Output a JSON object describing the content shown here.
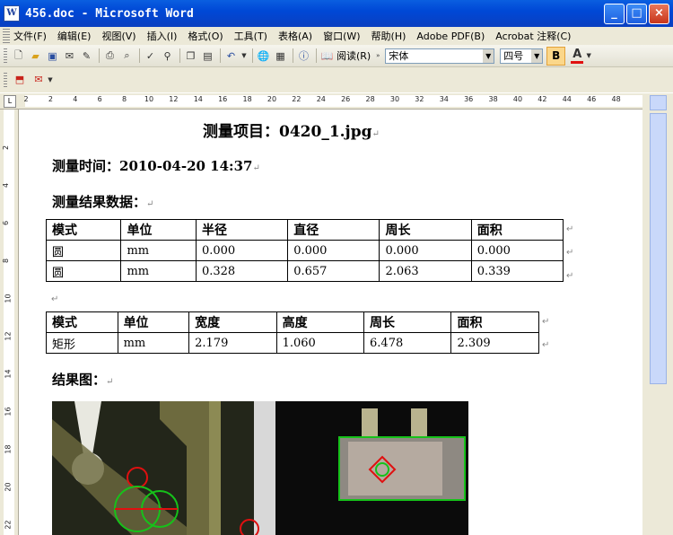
{
  "window": {
    "icon": "W",
    "title": "456.doc - Microsoft Word"
  },
  "menu": [
    "文件(F)",
    "编辑(E)",
    "视图(V)",
    "插入(I)",
    "格式(O)",
    "工具(T)",
    "表格(A)",
    "窗口(W)",
    "帮助(H)",
    "Adobe PDF(B)",
    "Acrobat 注释(C)"
  ],
  "toolbar": {
    "read_label": "阅读(R)",
    "font_name": "宋体",
    "font_size": "四号",
    "bold_label": "B",
    "color_label": "A"
  },
  "ruler": {
    "h_ticks": [
      "2",
      "2",
      "4",
      "6",
      "8",
      "10",
      "12",
      "14",
      "16",
      "18",
      "20",
      "22",
      "24",
      "26",
      "28",
      "30",
      "32",
      "34",
      "36",
      "38",
      "40",
      "42",
      "44",
      "46",
      "48"
    ],
    "v_ticks": [
      "2",
      "4",
      "6",
      "8",
      "10",
      "12",
      "14",
      "16",
      "18",
      "20",
      "22"
    ]
  },
  "document": {
    "title": "测量项目：0420_1.jpg",
    "time_label": "测量时间：2010-04-20   14:37",
    "results_heading": "测量结果数据：",
    "table1": {
      "headers": [
        "模式",
        "单位",
        "半径",
        "直径",
        "周长",
        "面积"
      ],
      "rows": [
        [
          "圆",
          "mm",
          "0.000",
          "0.000",
          "0.000",
          "0.000"
        ],
        [
          "圆",
          "mm",
          "0.328",
          "0.657",
          "2.063",
          "0.339"
        ]
      ]
    },
    "table2": {
      "headers": [
        "模式",
        "单位",
        "宽度",
        "高度",
        "周长",
        "面积"
      ],
      "rows": [
        [
          "矩形",
          "mm",
          "2.179",
          "1.060",
          "6.478",
          "2.309"
        ]
      ]
    },
    "image_heading": "结果图：",
    "paragraph_mark": "↵"
  }
}
